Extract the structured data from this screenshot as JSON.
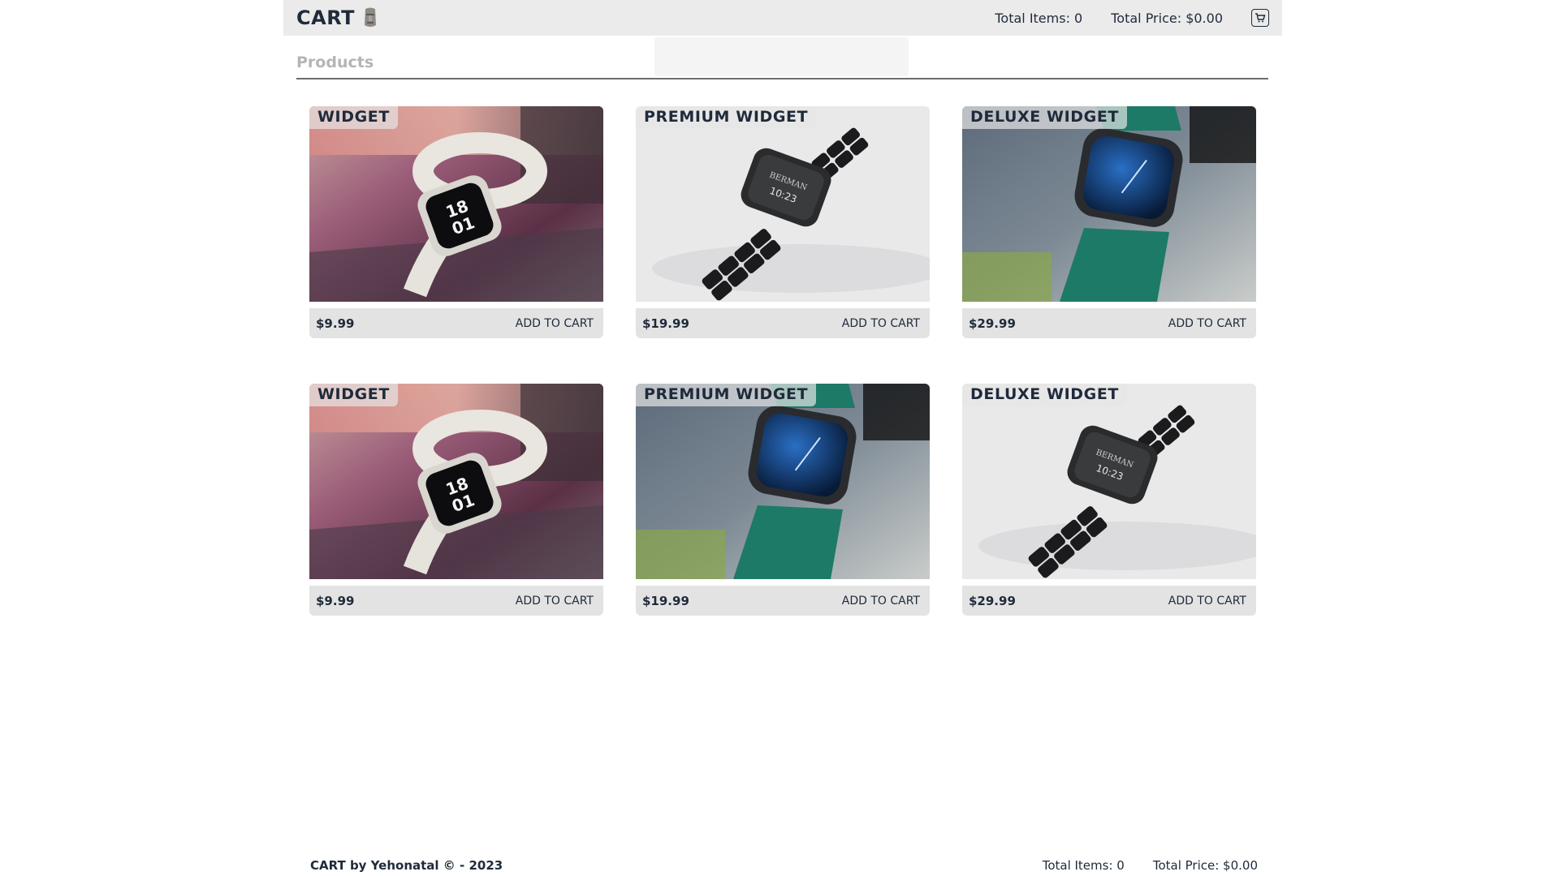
{
  "header": {
    "brand": "CART",
    "brand_icon": "moai-icon",
    "total_items": "Total Items: 0",
    "total_price": "Total Price: $0.00",
    "cart_icon": "cart-icon"
  },
  "toast": {
    "text": ""
  },
  "section": {
    "title": "Products"
  },
  "products": [
    {
      "title": "WIDGET",
      "price": "$9.99",
      "button": "ADD TO CART",
      "image": "white-band-watch"
    },
    {
      "title": "PREMIUM WIDGET",
      "price": "$19.99",
      "button": "ADD TO CART",
      "image": "black-link-watch"
    },
    {
      "title": "DELUXE WIDGET",
      "price": "$29.99",
      "button": "ADD TO CART",
      "image": "green-band-watch"
    },
    {
      "title": "WIDGET",
      "price": "$9.99",
      "button": "ADD TO CART",
      "image": "white-band-watch"
    },
    {
      "title": "PREMIUM WIDGET",
      "price": "$19.99",
      "button": "ADD TO CART",
      "image": "green-band-watch"
    },
    {
      "title": "DELUXE WIDGET",
      "price": "$29.99",
      "button": "ADD TO CART",
      "image": "black-link-watch"
    }
  ],
  "footer": {
    "credit": "CART by Yehonatal © - 2023",
    "total_items": "Total Items: 0",
    "total_price": "Total Price: $0.00"
  },
  "colors": {
    "header_bg": "#ebebeb",
    "text": "#1f2a3a",
    "muted_heading": "#b5b5b5",
    "card_footer_bg": "#e3e3e3"
  }
}
